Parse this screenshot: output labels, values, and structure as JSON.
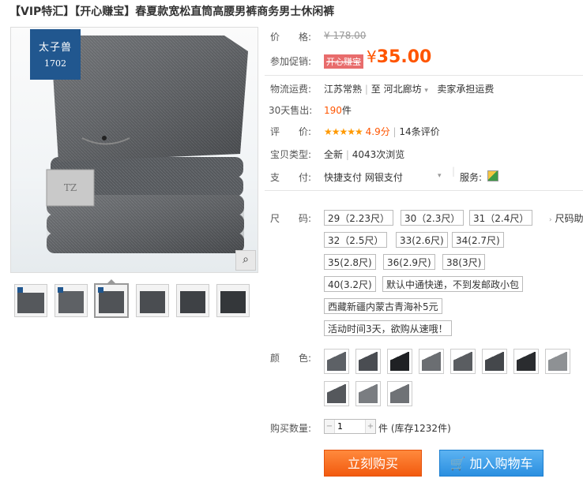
{
  "title": "【VIP特汇】【开心赚宝】春夏款宽松直筒高腰男裤商务男士休闲裤",
  "brand": {
    "name": "太子兽",
    "code": "1702"
  },
  "gallery": {
    "zoom_icon": "magnifier-icon",
    "thumb_count": 6
  },
  "price": {
    "label": "价　　格:",
    "original": "¥ 178.00"
  },
  "promo": {
    "label": "参加促销:",
    "badge": "开心赚宝",
    "currency": "¥",
    "amount": "35.00"
  },
  "shipping": {
    "label": "物流运费:",
    "from": "江苏常熟",
    "to_prefix": "至",
    "to": "河北廊坊",
    "note": "卖家承担运费"
  },
  "sales": {
    "label": "30天售出:",
    "count": "190",
    "unit": "件"
  },
  "rating": {
    "label": "评　　价:",
    "stars": "★★★★★",
    "score": "4.9分",
    "reviews": "14条评价"
  },
  "type": {
    "label": "宝贝类型:",
    "value": "全新",
    "views": "4043次浏览"
  },
  "payment": {
    "label": "支　　付:",
    "method1": "快捷支付",
    "method2": "网银支付",
    "service_label": "服务:"
  },
  "size": {
    "label": "尺　　码:",
    "chart_link": "尺码助",
    "options": [
      "29（2.23尺）",
      "30（2.3尺）",
      "31（2.4尺）",
      "32（2.5尺）",
      "33(2.6尺)",
      "34(2.7尺)",
      "35(2.8尺)",
      "36(2.9尺)",
      "38(3尺)",
      "40(3.2尺)"
    ],
    "notes": [
      "默认中通快递，不到发邮政小包",
      "西藏新疆内蒙古青海补5元",
      "活动时间3天，欲购从速哦！"
    ]
  },
  "color": {
    "label": "颜　　色:",
    "swatches": [
      "#5d6166",
      "#4a4d52",
      "#1f2124",
      "#6b6e72",
      "#5a5d61",
      "#44474b",
      "#2a2c2f",
      "#8e9194",
      "#55585c",
      "#7a7d81",
      "#6f7276"
    ]
  },
  "quantity": {
    "label": "购买数量:",
    "value": "1",
    "unit": "件",
    "stock": "(库存1232件)"
  },
  "buttons": {
    "buy": "立刻购买",
    "cart": "加入购物车",
    "cart_icon": "shopping-cart-icon"
  }
}
